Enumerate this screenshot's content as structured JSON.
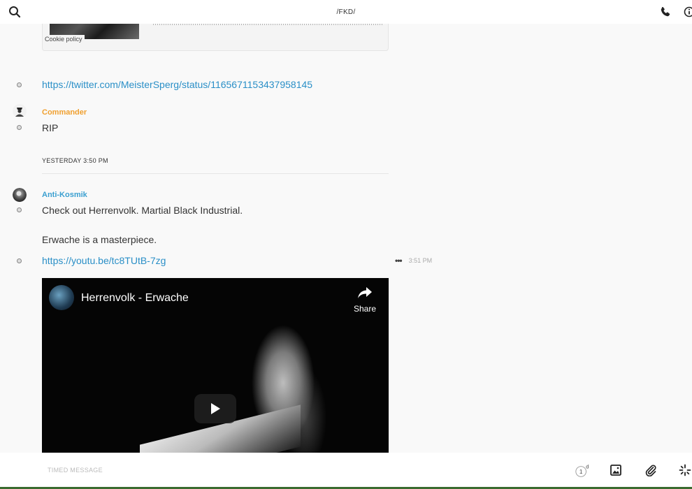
{
  "header": {
    "title": "/FKD/"
  },
  "embed": {
    "cookie_label": "Cookie policy"
  },
  "messages": [
    {
      "link": "https://twitter.com/MeisterSperg/status/1165671153437958145"
    },
    {
      "author": "Commander",
      "author_color": "#f0a030",
      "text": "RIP"
    },
    {
      "author": "Anti-Kosmik",
      "author_color": "#3a9fd0",
      "text_1": "Check out Herrenvolk. Martial Black Industrial.",
      "text_2": "Erwache is a masterpiece.",
      "link": "https://youtu.be/tc8TUtB-7zg",
      "time": "3:51 PM"
    }
  ],
  "date_separator": "YESTERDAY 3:50 PM",
  "video": {
    "title": "Herrenvolk - Erwache",
    "share_label": "Share"
  },
  "composer": {
    "timed_label": "TIMED MESSAGE",
    "timer_value": "1",
    "timer_unit": "d"
  },
  "icons": {
    "search": "search-icon",
    "phone": "phone-icon",
    "info": "info-icon",
    "image": "image-icon",
    "attach": "paperclip-icon",
    "effects": "sparkle-icon",
    "more": "more-dots-icon",
    "play": "play-icon",
    "share": "share-arrow-icon"
  }
}
